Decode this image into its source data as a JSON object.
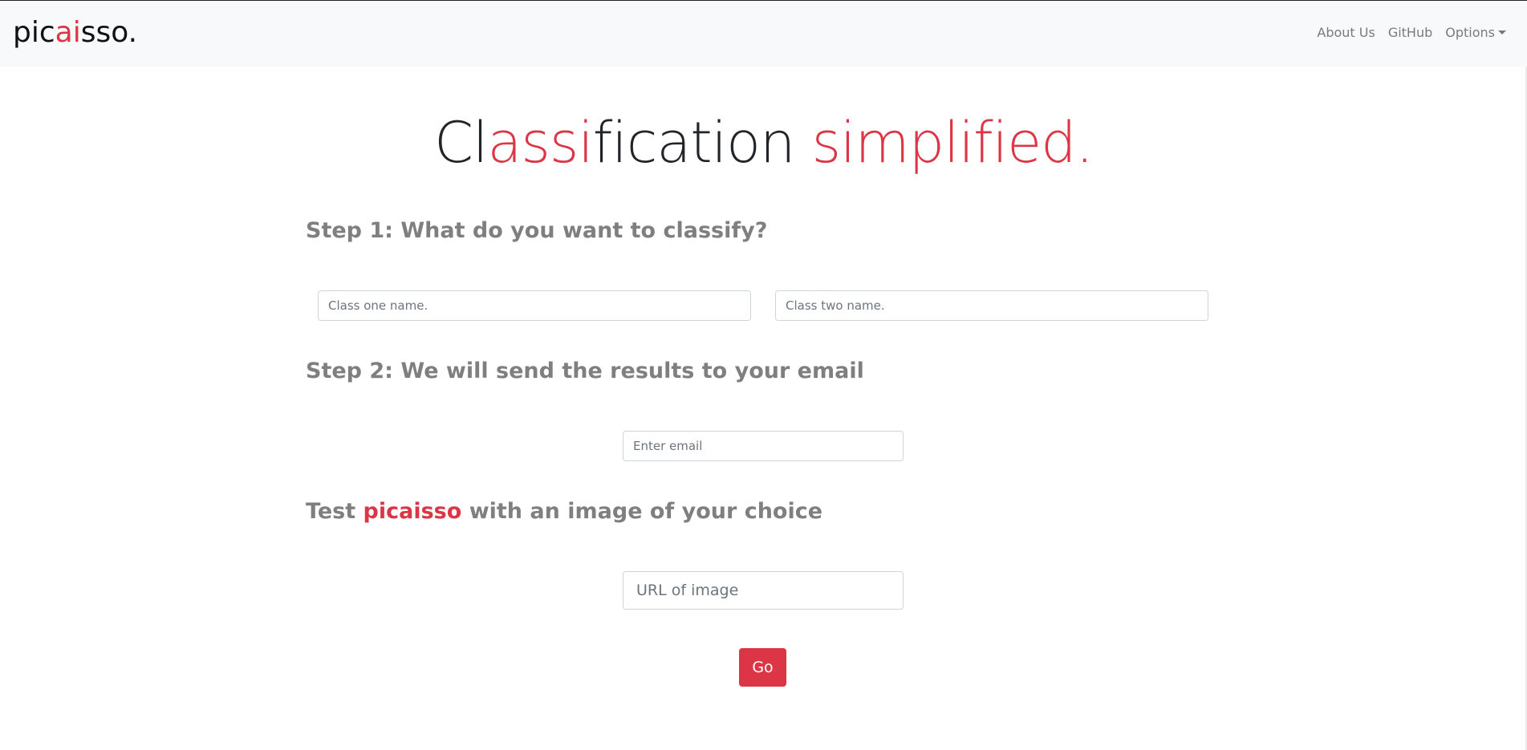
{
  "nav": {
    "brand_pre": "pic",
    "brand_ai": "ai",
    "brand_post": "sso.",
    "links": [
      "About Us",
      "GitHub"
    ],
    "options_label": "Options"
  },
  "hero": {
    "part1": "Cl",
    "part2": "ass",
    "part3": "i",
    "part4": "fication ",
    "part5": "simplified."
  },
  "step1": {
    "title": "Step 1: What do you want to classify?",
    "class_one_placeholder": "Class one name.",
    "class_two_placeholder": "Class two name."
  },
  "step2": {
    "title": "Step 2: We will send the results to your email",
    "email_placeholder": "Enter email"
  },
  "test": {
    "title_pre": "Test ",
    "title_brand": "picaisso",
    "title_post": " with an image of your choice",
    "url_placeholder": "URL of image",
    "go_label": "Go"
  },
  "colors": {
    "accent": "#dc3545",
    "navbar_bg": "#f8f9fa",
    "heading_gray": "#7f7f7f"
  }
}
